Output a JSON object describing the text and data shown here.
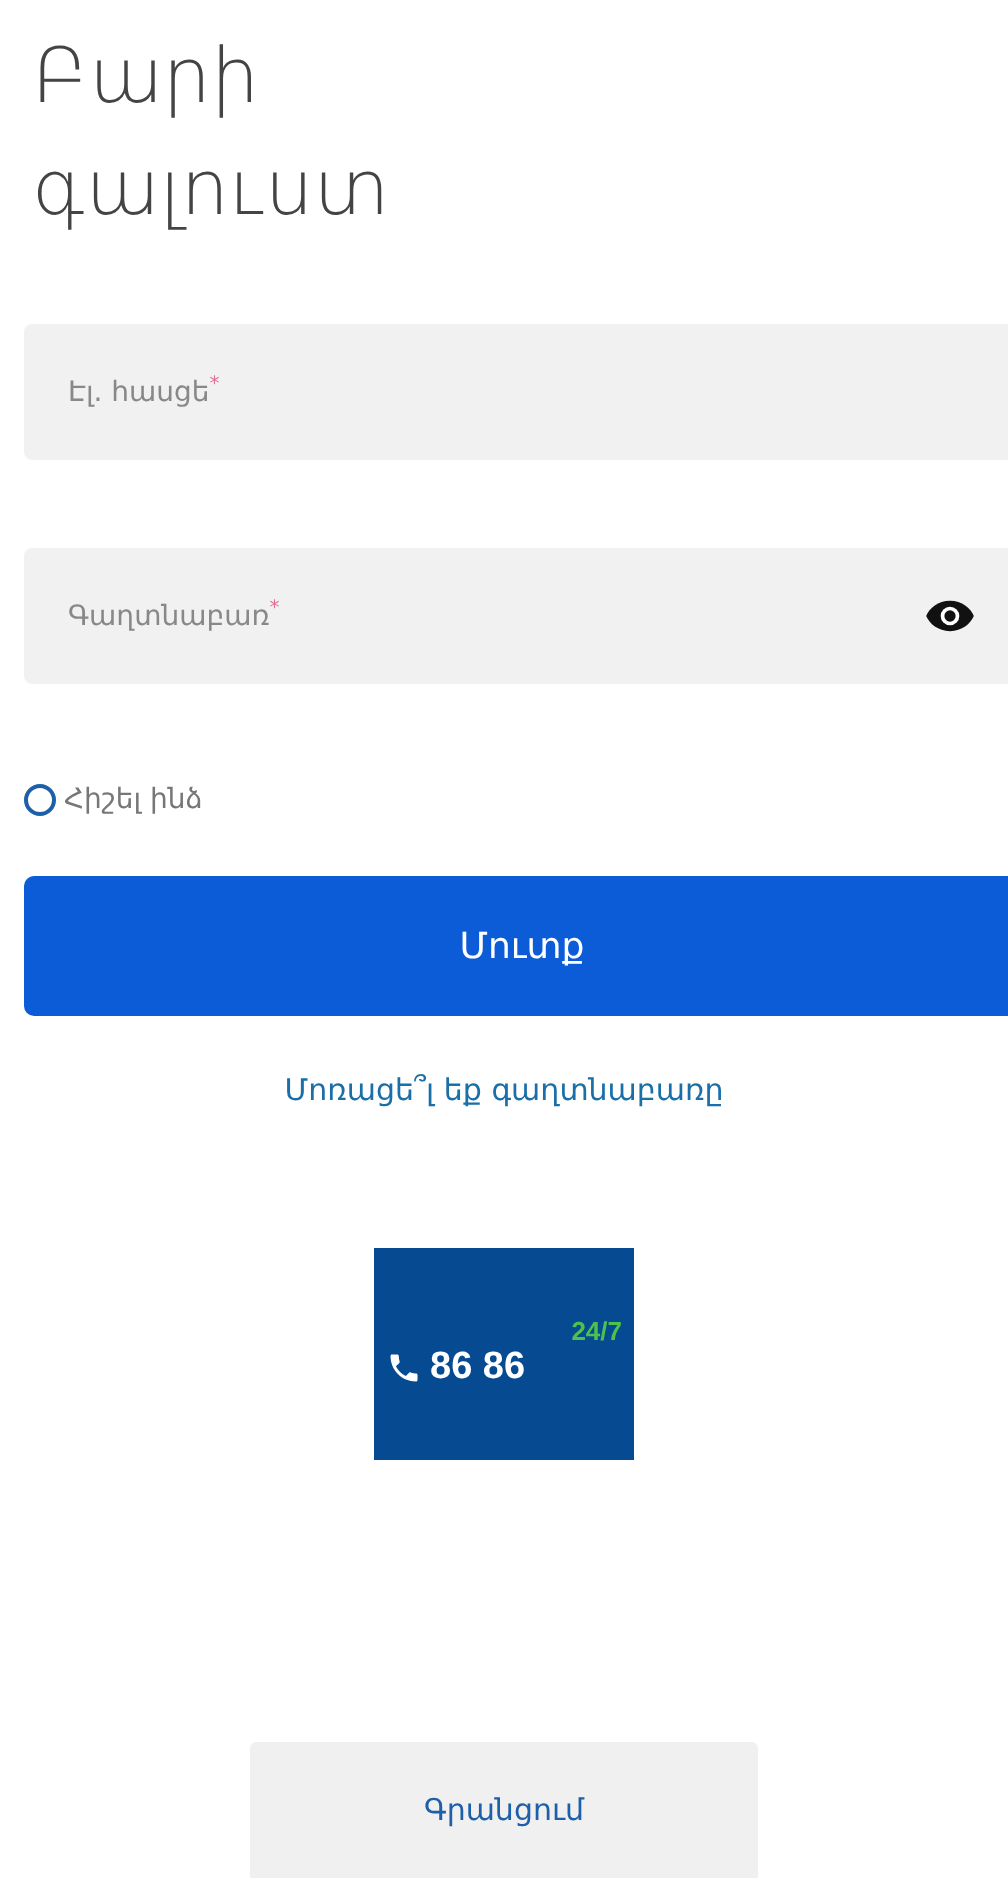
{
  "title": "Բարի գալուստ",
  "fields": [
    {
      "kind": "text",
      "placeholder": "Էլ. հասցե",
      "required_mark": "*"
    },
    {
      "kind": "password",
      "placeholder": "Գաղտնաբառ",
      "required_mark": "*"
    }
  ],
  "remember": {
    "label": "Հիշել ինձ",
    "checked": false
  },
  "login_button": "Մուտք",
  "forgot_link": "Մոռացե՞լ եք գաղտնաբառը",
  "hotline": {
    "number": "86 86",
    "hours": "24/7"
  },
  "register_button": "Գրանցում"
}
